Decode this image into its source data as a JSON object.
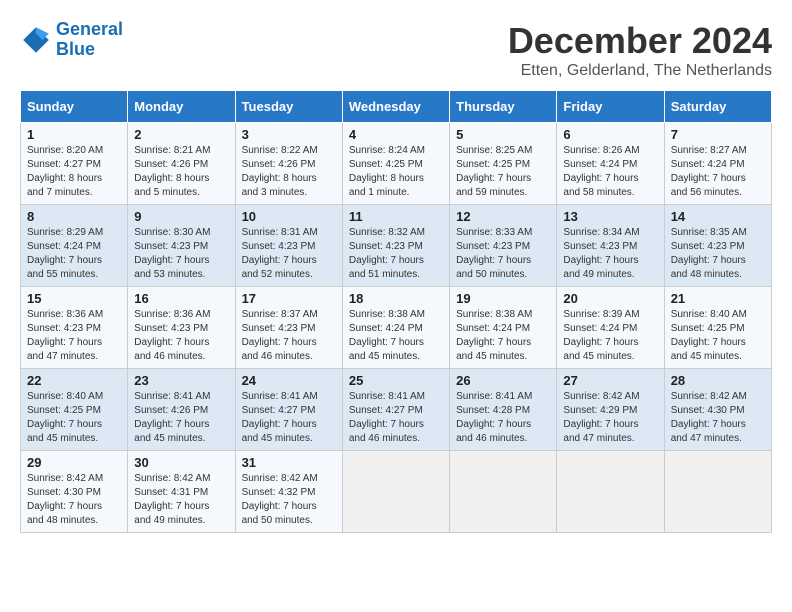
{
  "header": {
    "logo_line1": "General",
    "logo_line2": "Blue",
    "month_title": "December 2024",
    "subtitle": "Etten, Gelderland, The Netherlands"
  },
  "days_of_week": [
    "Sunday",
    "Monday",
    "Tuesday",
    "Wednesday",
    "Thursday",
    "Friday",
    "Saturday"
  ],
  "weeks": [
    [
      {
        "day": "1",
        "sunrise": "8:20 AM",
        "sunset": "4:27 PM",
        "daylight": "8 hours and 7 minutes."
      },
      {
        "day": "2",
        "sunrise": "8:21 AM",
        "sunset": "4:26 PM",
        "daylight": "8 hours and 5 minutes."
      },
      {
        "day": "3",
        "sunrise": "8:22 AM",
        "sunset": "4:26 PM",
        "daylight": "8 hours and 3 minutes."
      },
      {
        "day": "4",
        "sunrise": "8:24 AM",
        "sunset": "4:25 PM",
        "daylight": "8 hours and 1 minute."
      },
      {
        "day": "5",
        "sunrise": "8:25 AM",
        "sunset": "4:25 PM",
        "daylight": "7 hours and 59 minutes."
      },
      {
        "day": "6",
        "sunrise": "8:26 AM",
        "sunset": "4:24 PM",
        "daylight": "7 hours and 58 minutes."
      },
      {
        "day": "7",
        "sunrise": "8:27 AM",
        "sunset": "4:24 PM",
        "daylight": "7 hours and 56 minutes."
      }
    ],
    [
      {
        "day": "8",
        "sunrise": "8:29 AM",
        "sunset": "4:24 PM",
        "daylight": "7 hours and 55 minutes."
      },
      {
        "day": "9",
        "sunrise": "8:30 AM",
        "sunset": "4:23 PM",
        "daylight": "7 hours and 53 minutes."
      },
      {
        "day": "10",
        "sunrise": "8:31 AM",
        "sunset": "4:23 PM",
        "daylight": "7 hours and 52 minutes."
      },
      {
        "day": "11",
        "sunrise": "8:32 AM",
        "sunset": "4:23 PM",
        "daylight": "7 hours and 51 minutes."
      },
      {
        "day": "12",
        "sunrise": "8:33 AM",
        "sunset": "4:23 PM",
        "daylight": "7 hours and 50 minutes."
      },
      {
        "day": "13",
        "sunrise": "8:34 AM",
        "sunset": "4:23 PM",
        "daylight": "7 hours and 49 minutes."
      },
      {
        "day": "14",
        "sunrise": "8:35 AM",
        "sunset": "4:23 PM",
        "daylight": "7 hours and 48 minutes."
      }
    ],
    [
      {
        "day": "15",
        "sunrise": "8:36 AM",
        "sunset": "4:23 PM",
        "daylight": "7 hours and 47 minutes."
      },
      {
        "day": "16",
        "sunrise": "8:36 AM",
        "sunset": "4:23 PM",
        "daylight": "7 hours and 46 minutes."
      },
      {
        "day": "17",
        "sunrise": "8:37 AM",
        "sunset": "4:23 PM",
        "daylight": "7 hours and 46 minutes."
      },
      {
        "day": "18",
        "sunrise": "8:38 AM",
        "sunset": "4:24 PM",
        "daylight": "7 hours and 45 minutes."
      },
      {
        "day": "19",
        "sunrise": "8:38 AM",
        "sunset": "4:24 PM",
        "daylight": "7 hours and 45 minutes."
      },
      {
        "day": "20",
        "sunrise": "8:39 AM",
        "sunset": "4:24 PM",
        "daylight": "7 hours and 45 minutes."
      },
      {
        "day": "21",
        "sunrise": "8:40 AM",
        "sunset": "4:25 PM",
        "daylight": "7 hours and 45 minutes."
      }
    ],
    [
      {
        "day": "22",
        "sunrise": "8:40 AM",
        "sunset": "4:25 PM",
        "daylight": "7 hours and 45 minutes."
      },
      {
        "day": "23",
        "sunrise": "8:41 AM",
        "sunset": "4:26 PM",
        "daylight": "7 hours and 45 minutes."
      },
      {
        "day": "24",
        "sunrise": "8:41 AM",
        "sunset": "4:27 PM",
        "daylight": "7 hours and 45 minutes."
      },
      {
        "day": "25",
        "sunrise": "8:41 AM",
        "sunset": "4:27 PM",
        "daylight": "7 hours and 46 minutes."
      },
      {
        "day": "26",
        "sunrise": "8:41 AM",
        "sunset": "4:28 PM",
        "daylight": "7 hours and 46 minutes."
      },
      {
        "day": "27",
        "sunrise": "8:42 AM",
        "sunset": "4:29 PM",
        "daylight": "7 hours and 47 minutes."
      },
      {
        "day": "28",
        "sunrise": "8:42 AM",
        "sunset": "4:30 PM",
        "daylight": "7 hours and 47 minutes."
      }
    ],
    [
      {
        "day": "29",
        "sunrise": "8:42 AM",
        "sunset": "4:30 PM",
        "daylight": "7 hours and 48 minutes."
      },
      {
        "day": "30",
        "sunrise": "8:42 AM",
        "sunset": "4:31 PM",
        "daylight": "7 hours and 49 minutes."
      },
      {
        "day": "31",
        "sunrise": "8:42 AM",
        "sunset": "4:32 PM",
        "daylight": "7 hours and 50 minutes."
      },
      null,
      null,
      null,
      null
    ]
  ]
}
